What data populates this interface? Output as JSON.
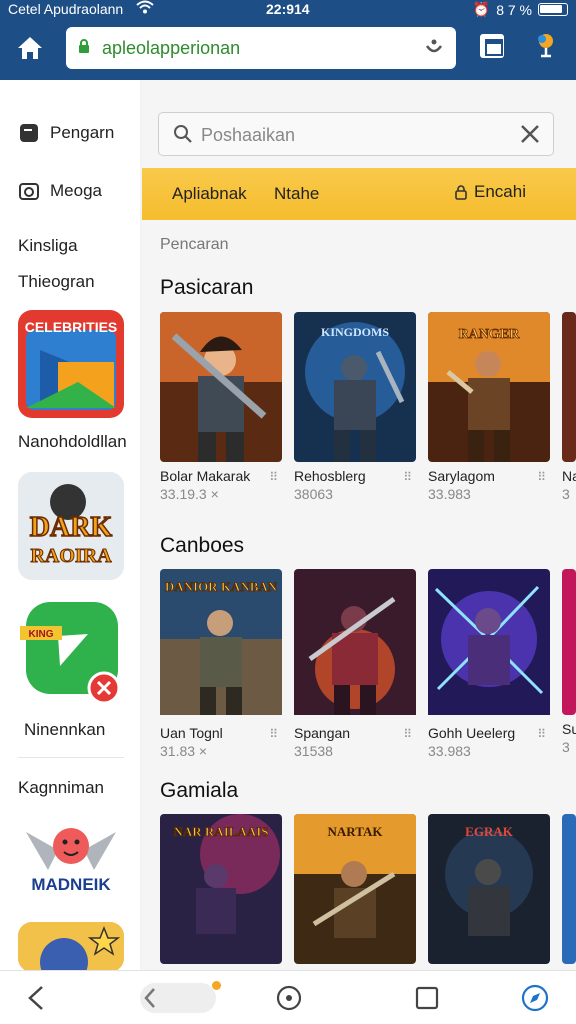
{
  "status_bar": {
    "carrier": "Cetel Apudraolann",
    "time": "22:914",
    "battery": "8 7 %"
  },
  "browser": {
    "url": "apleolapperionan"
  },
  "sidebar": {
    "item1": "Pengarn",
    "item2": "Meoga",
    "label1": "Kinsliga",
    "label2": "Thieogran",
    "app1_label": "Nanohdoldllan",
    "app2_text1": "DARK",
    "app2_text2": "RAOIRA",
    "app3_tag": "KING",
    "app3_label": "Ninennkan",
    "label3": "Kagnniman",
    "app4_text": "MADNEIK",
    "app1_title": "CELEBRITIES"
  },
  "search": {
    "placeholder": "Poshaaikan"
  },
  "filters": {
    "f1": "Apliabnak",
    "f2": "Ntahe",
    "f3": "Encahi"
  },
  "breadcrumb": "Pencaran",
  "sections": [
    {
      "title": "Pasicaran",
      "cards": [
        {
          "name": "Bolar Makarak",
          "meta": "33.19.3 ×"
        },
        {
          "name": "Rehosblerg",
          "meta": "38063"
        },
        {
          "name": "Sarylagom",
          "meta": "33.983"
        },
        {
          "name": "Na",
          "meta": "3"
        }
      ]
    },
    {
      "title": "Canboes",
      "cards": [
        {
          "name": "Uan Tognl",
          "meta": "31.83 ×"
        },
        {
          "name": "Spangan",
          "meta": "31538"
        },
        {
          "name": "Gohh Ueelerg",
          "meta": "33.983"
        },
        {
          "name": "Su",
          "meta": "3"
        }
      ]
    },
    {
      "title": "Gamiala",
      "cards": [
        {
          "name": "",
          "meta": ""
        },
        {
          "name": "",
          "meta": ""
        },
        {
          "name": "",
          "meta": ""
        },
        {
          "name": "",
          "meta": ""
        }
      ]
    }
  ],
  "card_art_titles": [
    "KINGDOMS",
    "RANGER",
    "",
    "DANIOR KANBAN",
    "",
    "",
    "NAR RAILAAIS",
    "NARTAK",
    "EGRAK"
  ],
  "colors": {
    "topbar": "#1d4f86",
    "filterbar": "#f6bd2e",
    "url_text": "#2e8b2e"
  }
}
